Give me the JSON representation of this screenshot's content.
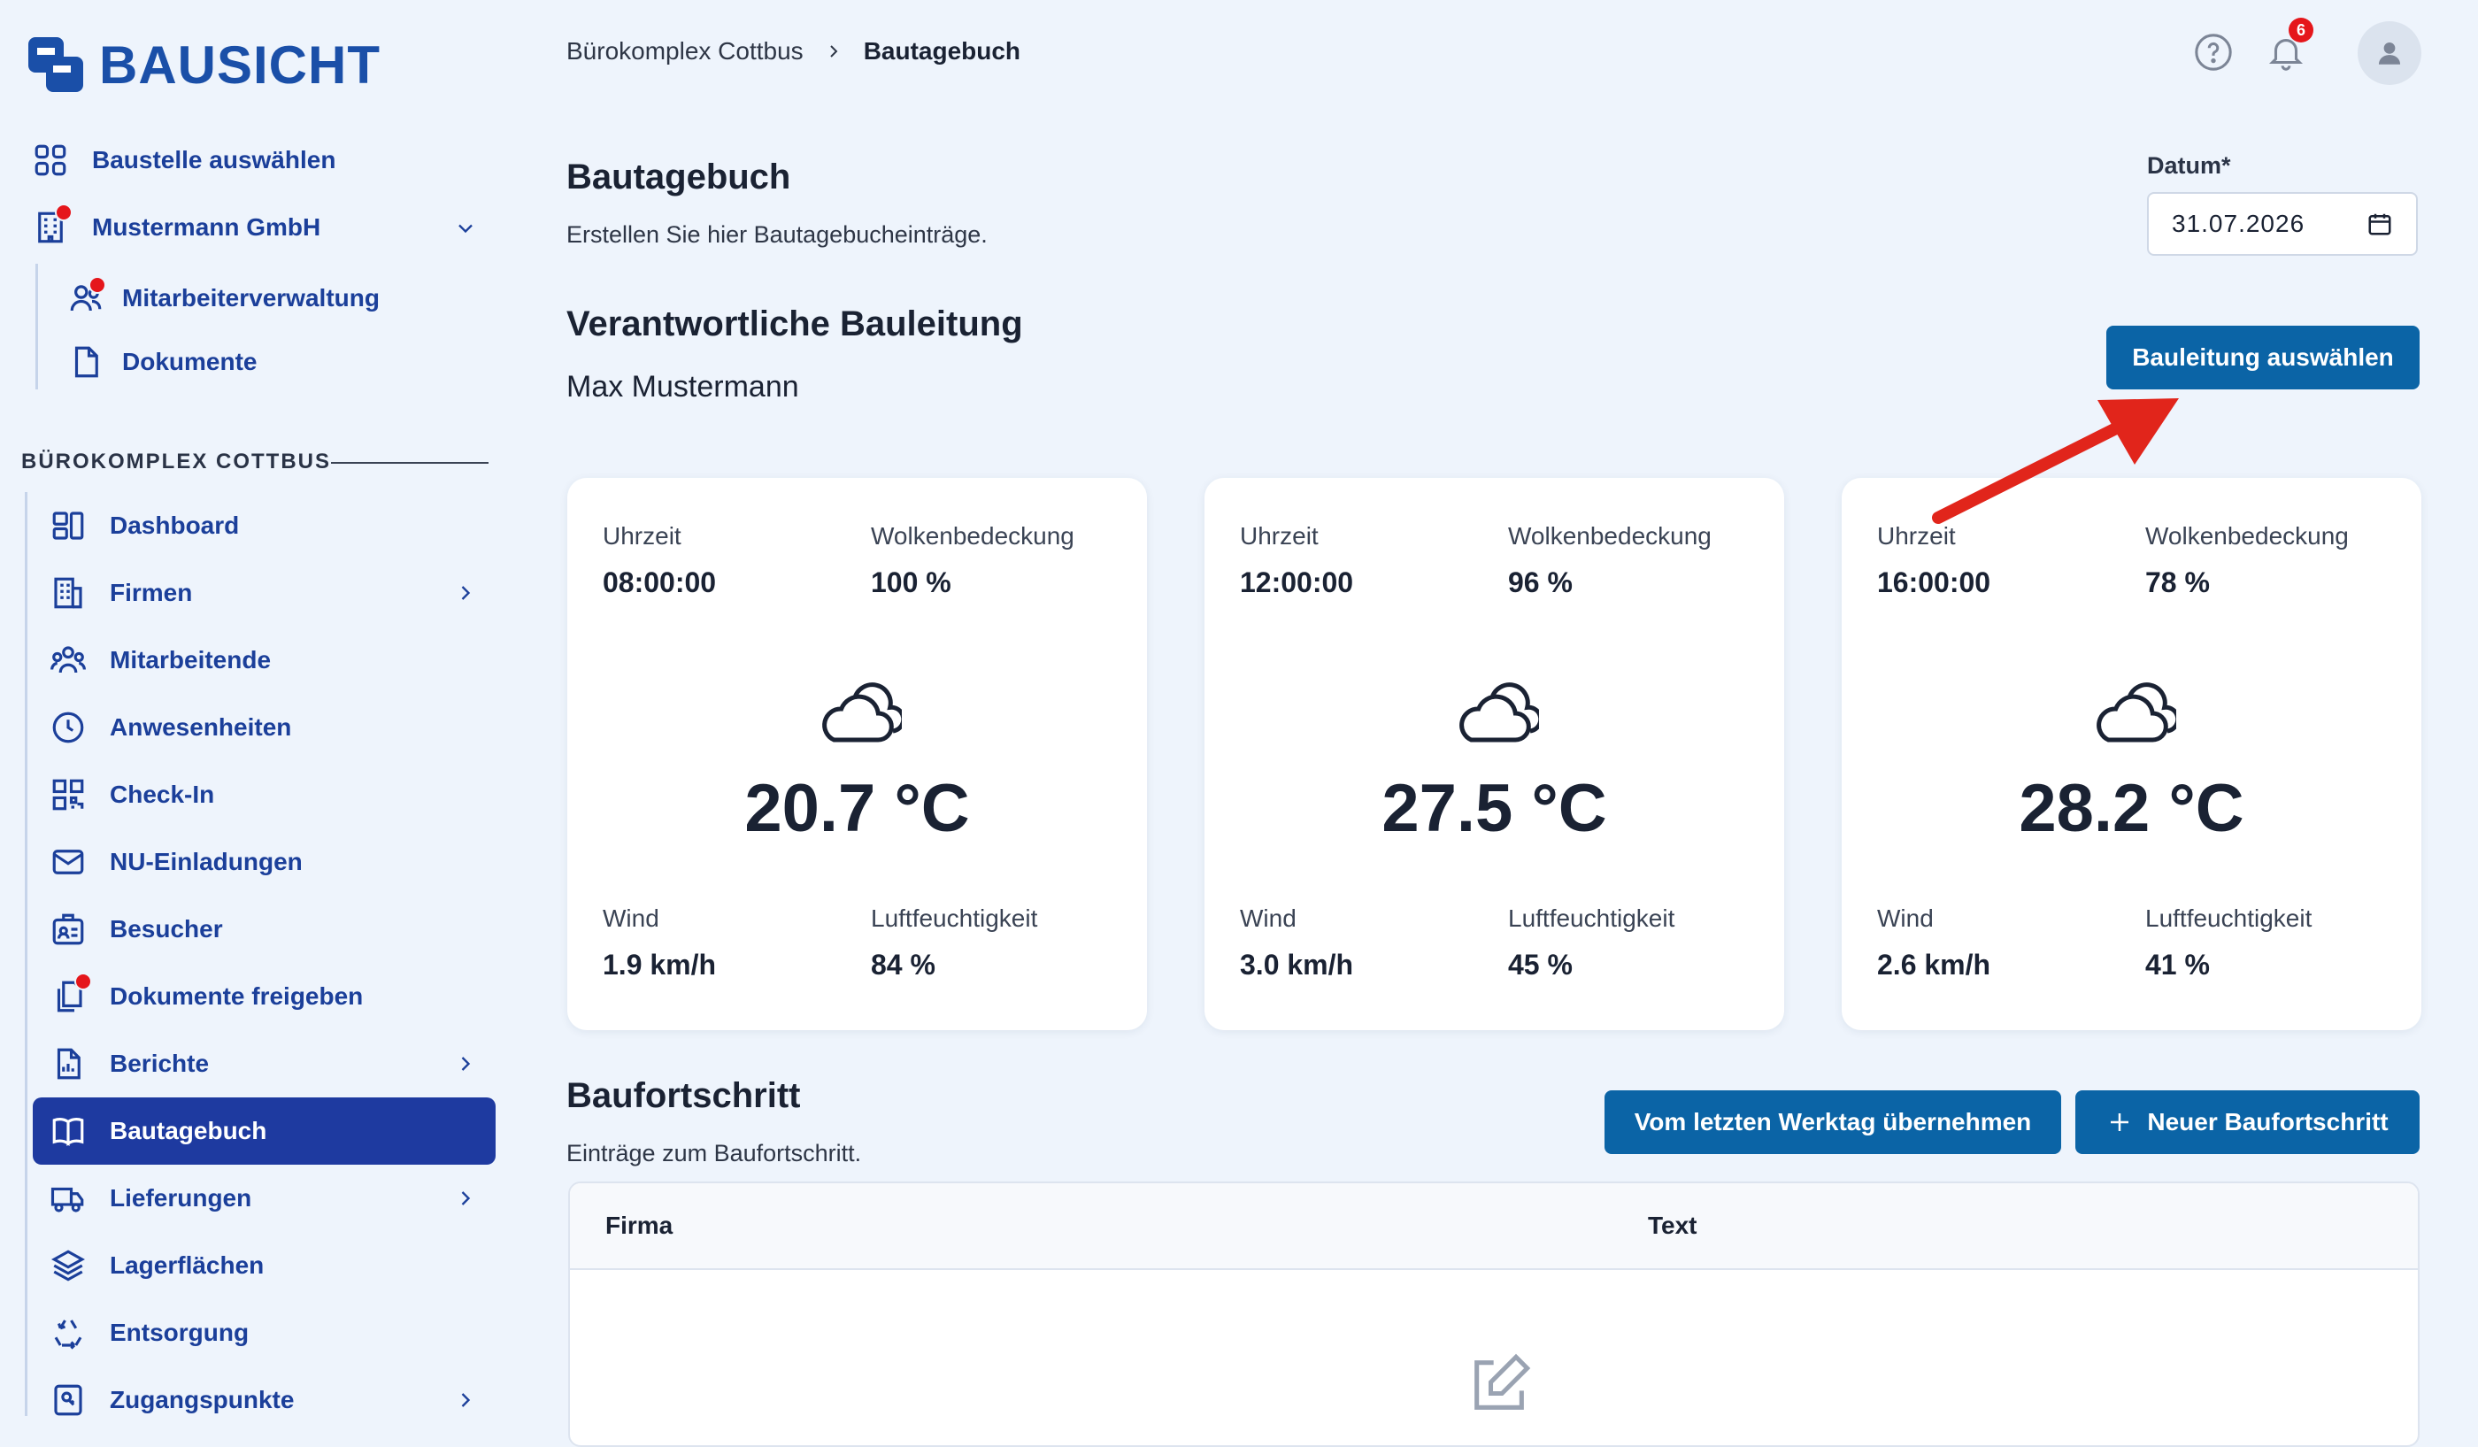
{
  "brand": {
    "name": "BAUSICHT"
  },
  "sidebar": {
    "top_items": [
      {
        "label": "Baustelle auswählen",
        "icon": "grid-icon"
      },
      {
        "label": "Mustermann GmbH",
        "icon": "building-icon",
        "dot": true
      },
      {
        "label": "Mitarbeiterverwaltung",
        "icon": "users-icon",
        "dot": true
      },
      {
        "label": "Dokumente",
        "icon": "document-icon"
      }
    ],
    "section_title": "BÜROKOMPLEX COTTBUS",
    "items": [
      {
        "label": "Dashboard",
        "icon": "dashboard-icon"
      },
      {
        "label": "Firmen",
        "icon": "company-icon",
        "chevron": true
      },
      {
        "label": "Mitarbeitende",
        "icon": "team-icon"
      },
      {
        "label": "Anwesenheiten",
        "icon": "clock-icon"
      },
      {
        "label": "Check-In",
        "icon": "qr-icon"
      },
      {
        "label": "NU-Einladungen",
        "icon": "mail-icon"
      },
      {
        "label": "Besucher",
        "icon": "badge-icon"
      },
      {
        "label": "Dokumente freigeben",
        "icon": "documents-icon",
        "dot": true
      },
      {
        "label": "Berichte",
        "icon": "report-icon",
        "chevron": true
      },
      {
        "label": "Bautagebuch",
        "icon": "book-icon",
        "active": true
      },
      {
        "label": "Lieferungen",
        "icon": "truck-icon",
        "chevron": true
      },
      {
        "label": "Lagerflächen",
        "icon": "layers-icon"
      },
      {
        "label": "Entsorgung",
        "icon": "recycle-icon"
      },
      {
        "label": "Zugangspunkte",
        "icon": "key-icon",
        "chevron": true
      }
    ]
  },
  "header": {
    "breadcrumb": [
      "Bürokomplex Cottbus",
      "Bautagebuch"
    ],
    "notifications": "6"
  },
  "main": {
    "title": "Bautagebuch",
    "subtitle": "Erstellen Sie hier Bautagebucheinträge.",
    "date_label": "Datum*",
    "date_value": "31.07.2026",
    "manager_title": "Verantwortliche Bauleitung",
    "manager_name": "Max Mustermann",
    "select_manager_button": "Bauleitung auswählen",
    "weather": [
      {
        "time_label": "Uhrzeit",
        "time": "08:00:00",
        "cloud_label": "Wolkenbedeckung",
        "cloud": "100 %",
        "temp": "20.7 °C",
        "wind_label": "Wind",
        "wind": "1.9 km/h",
        "humidity_label": "Luftfeuchtigkeit",
        "humidity": "84 %"
      },
      {
        "time_label": "Uhrzeit",
        "time": "12:00:00",
        "cloud_label": "Wolkenbedeckung",
        "cloud": "96 %",
        "temp": "27.5 °C",
        "wind_label": "Wind",
        "wind": "3.0 km/h",
        "humidity_label": "Luftfeuchtigkeit",
        "humidity": "45 %"
      },
      {
        "time_label": "Uhrzeit",
        "time": "16:00:00",
        "cloud_label": "Wolkenbedeckung",
        "cloud": "78 %",
        "temp": "28.2 °C",
        "wind_label": "Wind",
        "wind": "2.6 km/h",
        "humidity_label": "Luftfeuchtigkeit",
        "humidity": "41 %"
      }
    ],
    "progress_title": "Baufortschritt",
    "progress_subtitle": "Einträge zum Baufortschritt.",
    "copy_button": "Vom letzten Werktag übernehmen",
    "new_button": "Neuer Baufortschritt",
    "table_headers": [
      "Firma",
      "Text"
    ]
  },
  "colors": {
    "accent": "#0b64a6",
    "nav_active": "#1e3aa0",
    "nav_text": "#1b3f9a",
    "annotation_arrow": "#e1251b"
  }
}
